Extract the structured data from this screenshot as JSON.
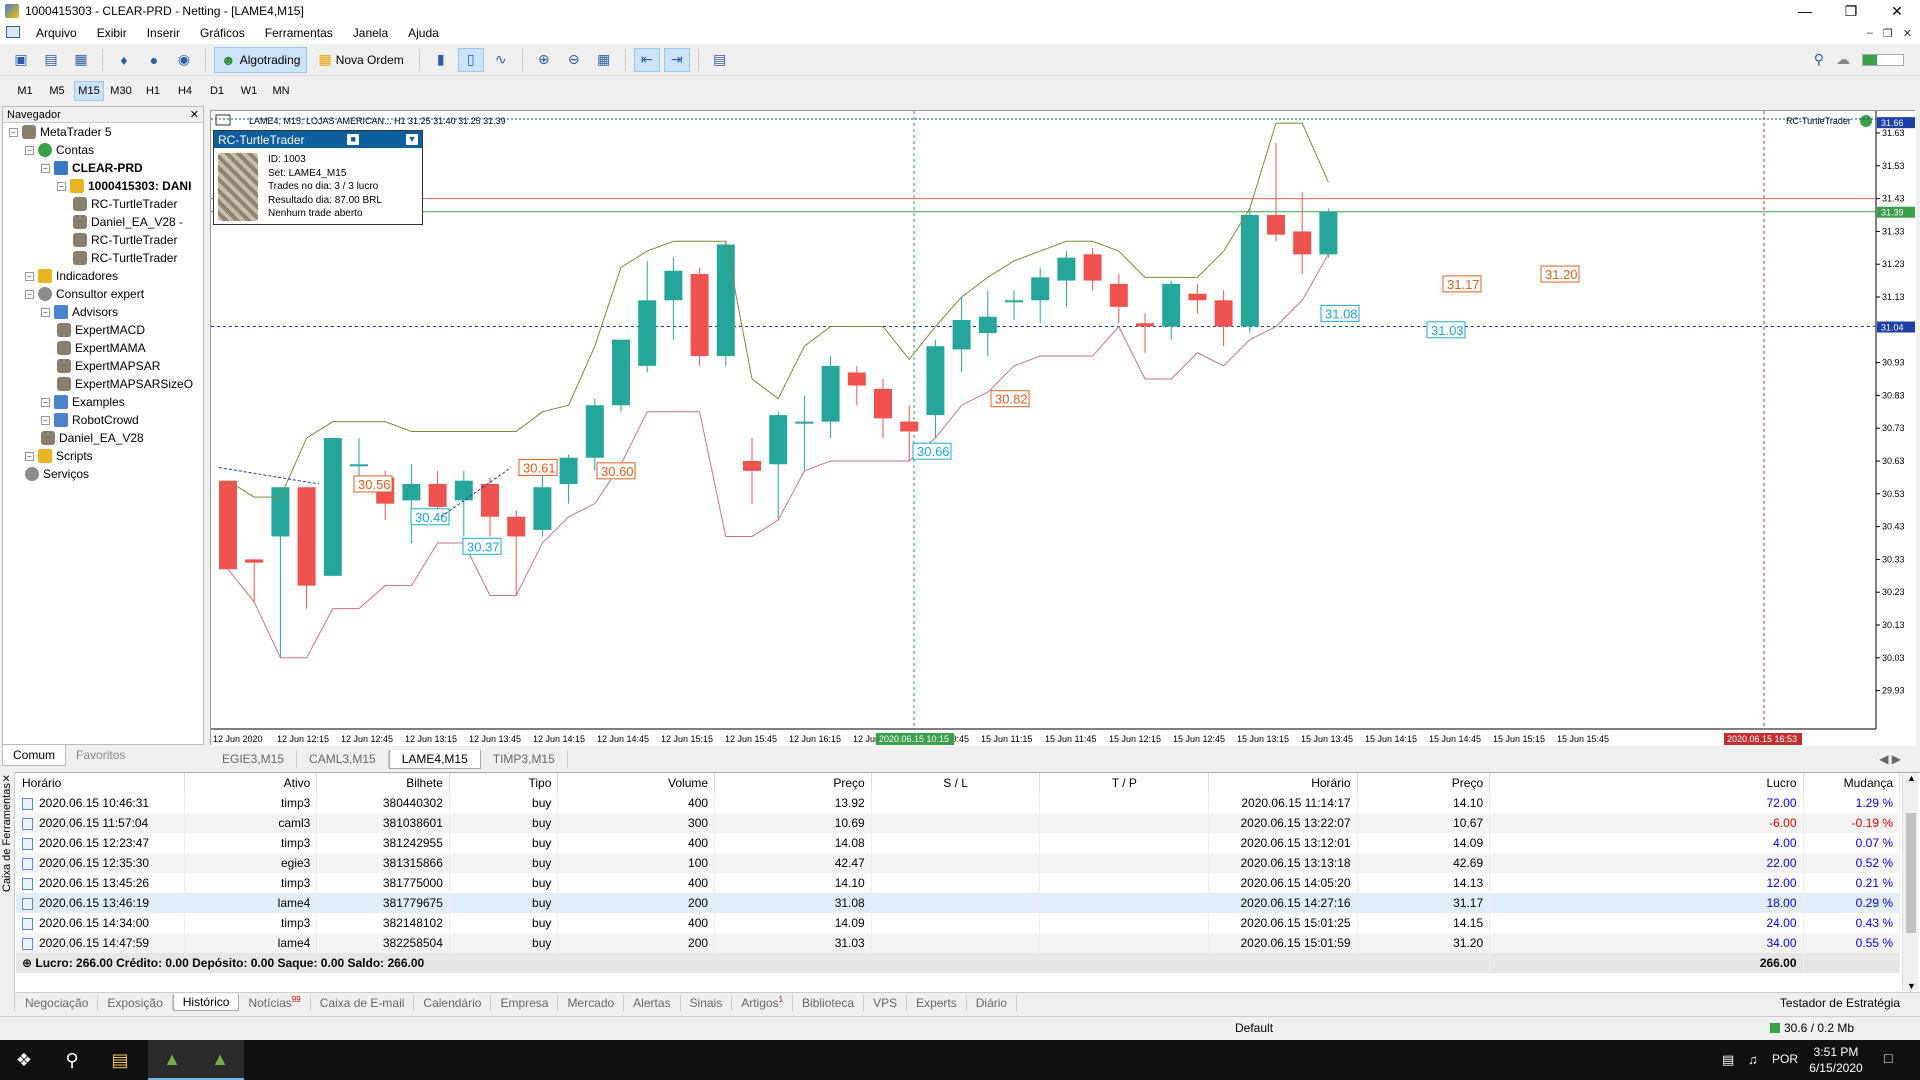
{
  "window": {
    "title": "1000415303 - CLEAR-PRD - Netting - [LAME4,M15]"
  },
  "menu": [
    "Arquivo",
    "Exibir",
    "Inserir",
    "Gráficos",
    "Ferramentas",
    "Janela",
    "Ajuda"
  ],
  "toolbar": {
    "algotrading": "Algotrading",
    "nova_ordem": "Nova Ordem"
  },
  "timeframes": [
    "M1",
    "M5",
    "M15",
    "M30",
    "H1",
    "H4",
    "D1",
    "W1",
    "MN"
  ],
  "navigator": {
    "title": "Navegador",
    "items": [
      {
        "label": "MetaTrader 5",
        "level": 0
      },
      {
        "label": "Contas",
        "level": 1
      },
      {
        "label": "CLEAR-PRD",
        "level": 2,
        "bold": true
      },
      {
        "label": "1000415303: DANI",
        "level": 3,
        "bold": true
      },
      {
        "label": "RC-TurtleTrader",
        "level": 4
      },
      {
        "label": "Daniel_EA_V28 -",
        "level": 4
      },
      {
        "label": "RC-TurtleTrader",
        "level": 4
      },
      {
        "label": "RC-TurtleTrader",
        "level": 4
      },
      {
        "label": "Indicadores",
        "level": 1
      },
      {
        "label": "Consultor expert",
        "level": 1
      },
      {
        "label": "Advisors",
        "level": 2
      },
      {
        "label": "ExpertMACD",
        "level": 3
      },
      {
        "label": "ExpertMAMA",
        "level": 3
      },
      {
        "label": "ExpertMAPSAR",
        "level": 3
      },
      {
        "label": "ExpertMAPSARSizeO",
        "level": 3
      },
      {
        "label": "Examples",
        "level": 2
      },
      {
        "label": "RobotCrowd",
        "level": 2
      },
      {
        "label": "Daniel_EA_V28",
        "level": 2
      },
      {
        "label": "Scripts",
        "level": 1
      },
      {
        "label": "Serviços",
        "level": 1
      }
    ],
    "tabs": [
      "Comum",
      "Favoritos"
    ]
  },
  "chart": {
    "header": "LAME4, M15: LOJAS AMERICAN...  H1 31.25 31.40 31.25 31.39",
    "ea_label": "RC-TurtleTrader",
    "price_labels": [
      "31.63",
      "31.53",
      "31.43",
      "31.33",
      "31.23",
      "31.13",
      "30.93",
      "30.83",
      "30.73",
      "30.63",
      "30.53",
      "30.43",
      "30.33",
      "30.23",
      "30.13",
      "30.03",
      "29.93"
    ],
    "price_current": "31.39",
    "price_top": "31.66",
    "price_hline": "31.04",
    "time_labels": [
      "12 Jun 2020",
      "12 Jun 12:15",
      "12 Jun 12:45",
      "12 Jun 13:15",
      "12 Jun 13:45",
      "12 Jun 14:15",
      "12 Jun 14:45",
      "12 Jun 15:15",
      "12 Jun 15:45",
      "12 Jun 16:15",
      "12 Jun",
      "15 Jun 10:45",
      "15 Jun 11:15",
      "15 Jun 11:45",
      "15 Jun 12:15",
      "15 Jun 12:45",
      "15 Jun 13:15",
      "15 Jun 13:45",
      "15 Jun 14:15",
      "15 Jun 14:45",
      "15 Jun 15:15",
      "15 Jun 15:45"
    ],
    "time_cursor": "2020.06.15 10:15",
    "time_end": "2020.06.15 16:53",
    "trade_labels": [
      "30.56",
      "30.46",
      "30.37",
      "30.61",
      "30.60",
      "30.66",
      "30.82",
      "31.08",
      "31.03",
      "31.17",
      "31.20"
    ],
    "tabs": [
      "EGIE3,M15",
      "CAML3,M15",
      "LAME4,M15",
      "TIMP3,M15"
    ],
    "colors": {
      "bull": "#26a69a",
      "bear": "#ef5350",
      "upper_band": "#7a8b3a",
      "lower_band": "#c9728a"
    }
  },
  "ea_panel": {
    "title": "RC-TurtleTrader",
    "lines": [
      "ID: 1003",
      "Set: LAME4_M15",
      "Trades no dia:  3 / 3 lucro",
      "Resultado dia: 87.00 BRL",
      "Nenhum trade aberto"
    ]
  },
  "history": {
    "columns": [
      "Horário",
      "Ativo",
      "Bilhete",
      "Tipo",
      "Volume",
      "Preço",
      "S / L",
      "T / P",
      "Horário",
      "Preço",
      "Lucro",
      "Mudança"
    ],
    "rows": [
      [
        "2020.06.15 10:46:31",
        "timp3",
        "380440302",
        "buy",
        "400",
        "13.92",
        "",
        "",
        "2020.06.15 11:14:17",
        "14.10",
        "72.00",
        "1.29 %"
      ],
      [
        "2020.06.15 11:57:04",
        "caml3",
        "381038601",
        "buy",
        "300",
        "10.69",
        "",
        "",
        "2020.06.15 13:22:07",
        "10.67",
        "-6.00",
        "-0.19 %"
      ],
      [
        "2020.06.15 12:23:47",
        "timp3",
        "381242955",
        "buy",
        "400",
        "14.08",
        "",
        "",
        "2020.06.15 13:12:01",
        "14.09",
        "4.00",
        "0.07 %"
      ],
      [
        "2020.06.15 12:35:30",
        "egie3",
        "381315866",
        "buy",
        "100",
        "42.47",
        "",
        "",
        "2020.06.15 13:13:18",
        "42.69",
        "22.00",
        "0.52 %"
      ],
      [
        "2020.06.15 13:45:26",
        "timp3",
        "381775000",
        "buy",
        "400",
        "14.10",
        "",
        "",
        "2020.06.15 14:05:20",
        "14.13",
        "12.00",
        "0.21 %"
      ],
      [
        "2020.06.15 13:46:19",
        "lame4",
        "381779675",
        "buy",
        "200",
        "31.08",
        "",
        "",
        "2020.06.15 14:27:16",
        "31.17",
        "18.00",
        "0.29 %"
      ],
      [
        "2020.06.15 14:34:00",
        "timp3",
        "382148102",
        "buy",
        "400",
        "14.09",
        "",
        "",
        "2020.06.15 15:01:25",
        "14.15",
        "24.00",
        "0.43 %"
      ],
      [
        "2020.06.15 14:47:59",
        "lame4",
        "382258504",
        "buy",
        "200",
        "31.03",
        "",
        "",
        "2020.06.15 15:01:59",
        "31.20",
        "34.00",
        "0.55 %"
      ]
    ],
    "summary": "Lucro: 266.00  Crédito: 0.00  Depósito: 0.00  Saque: 0.00  Saldo: 266.00",
    "summary_total": "266.00"
  },
  "toolbox": {
    "side_label": "Caixa de Ferramentas",
    "tabs": [
      "Negociação",
      "Exposição",
      "Histórico",
      "Notícias",
      "Caixa de E-mail",
      "Calendário",
      "Empresa",
      "Mercado",
      "Alertas",
      "Sinais",
      "Artigos",
      "Biblioteca",
      "VPS",
      "Experts",
      "Diário"
    ],
    "news_badge": "99",
    "articles_badge": "1",
    "strategy_tester": "Testador de Estratégia"
  },
  "status": {
    "profile": "Default",
    "traffic": "30.6 / 0.2 Mb"
  },
  "taskbar": {
    "time": "3:51 PM",
    "date": "6/15/2020",
    "lang": "POR"
  }
}
